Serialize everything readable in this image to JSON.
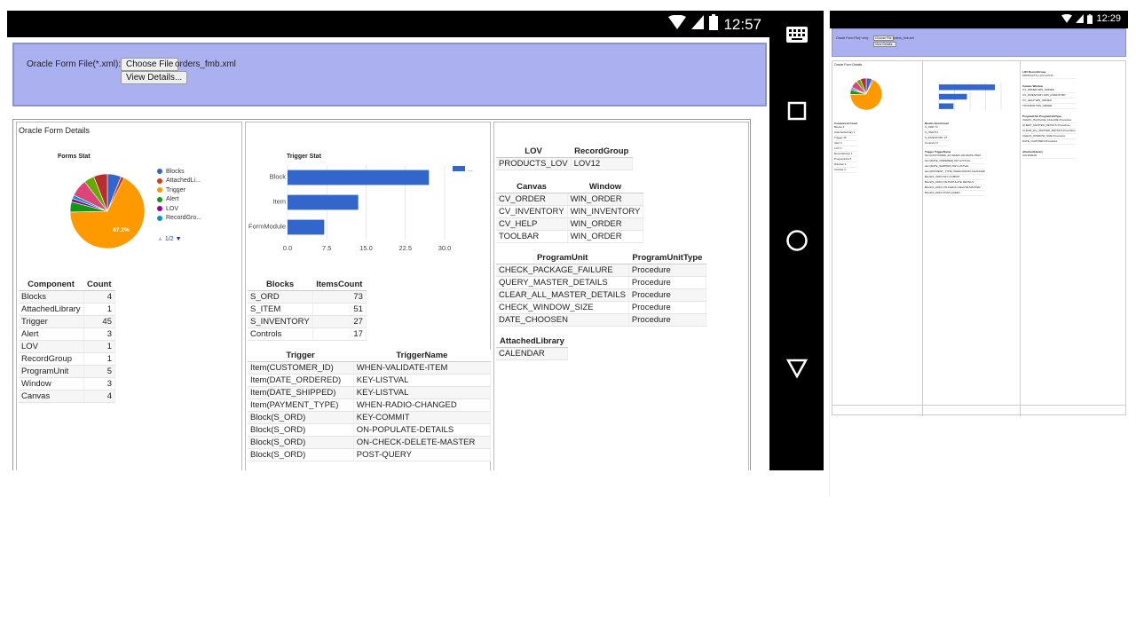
{
  "status_bar": {
    "time": "12:57"
  },
  "status_bar_portrait": {
    "time": "12:29"
  },
  "file_form": {
    "label": "Oracle Form File(*.xml):",
    "choose_button": "Choose File",
    "file_name": "orders_fmb.xml",
    "view_button": "View Details..."
  },
  "details": {
    "title": "Oracle Form Details"
  },
  "forms_stat_chart": {
    "title": "Forms Stat",
    "pie_label": "67.2%",
    "legend": [
      "Blocks",
      "AttachedLi...",
      "Trigger",
      "Alert",
      "LOV",
      "RecordGro..."
    ],
    "pager": "1/2"
  },
  "trigger_stat_chart": {
    "title": "Trigger Stat",
    "categories": [
      "Block",
      "Item",
      "FormModule"
    ],
    "ticks": [
      "0.0",
      "7.5",
      "15.0",
      "22.5",
      "30.0"
    ],
    "legend_text": "..."
  },
  "chart_data": [
    {
      "type": "pie",
      "title": "Forms Stat",
      "categories": [
        "Blocks",
        "AttachedLibrary",
        "Trigger",
        "Alert",
        "LOV",
        "RecordGroup",
        "ProgramUnit",
        "Window",
        "Canvas"
      ],
      "values": [
        4,
        1,
        45,
        3,
        1,
        1,
        5,
        3,
        4
      ],
      "colors": [
        "#3366cc",
        "#dc3912",
        "#ff9900",
        "#109618",
        "#990099",
        "#0099c6",
        "#dd4477",
        "#66aa00",
        "#b82e2e"
      ]
    },
    {
      "type": "bar",
      "orientation": "horizontal",
      "title": "Trigger Stat",
      "categories": [
        "Block",
        "Item",
        "FormModule"
      ],
      "values": [
        27,
        13.5,
        7
      ],
      "xlim": [
        0,
        30
      ]
    }
  ],
  "component_table": {
    "headers": [
      "Component",
      "Count"
    ],
    "rows": [
      [
        "Blocks",
        "4"
      ],
      [
        "AttachedLibrary",
        "1"
      ],
      [
        "Trigger",
        "45"
      ],
      [
        "Alert",
        "3"
      ],
      [
        "LOV",
        "1"
      ],
      [
        "RecordGroup",
        "1"
      ],
      [
        "ProgramUnit",
        "5"
      ],
      [
        "Window",
        "3"
      ],
      [
        "Canvas",
        "4"
      ]
    ]
  },
  "blocks_table": {
    "headers": [
      "Blocks",
      "ItemsCount"
    ],
    "rows": [
      [
        "S_ORD",
        "73"
      ],
      [
        "S_ITEM",
        "51"
      ],
      [
        "S_INVENTORY",
        "27"
      ],
      [
        "Controls",
        "17"
      ]
    ]
  },
  "trigger_table": {
    "headers": [
      "Trigger",
      "TriggerName"
    ],
    "rows": [
      [
        "Item(CUSTOMER_ID)",
        "WHEN-VALIDATE-ITEM"
      ],
      [
        "Item(DATE_ORDERED)",
        "KEY-LISTVAL"
      ],
      [
        "Item(DATE_SHIPPED)",
        "KEY-LISTVAL"
      ],
      [
        "Item(PAYMENT_TYPE)",
        "WHEN-RADIO-CHANGED"
      ],
      [
        "Block(S_ORD)",
        "KEY-COMMIT"
      ],
      [
        "Block(S_ORD)",
        "ON-POPULATE-DETAILS"
      ],
      [
        "Block(S_ORD)",
        "ON-CHECK-DELETE-MASTER"
      ],
      [
        "Block(S_ORD)",
        "POST-QUERY"
      ]
    ]
  },
  "lov_table": {
    "headers": [
      "LOV",
      "RecordGroup"
    ],
    "rows": [
      [
        "PRODUCTS_LOV",
        "LOV12"
      ]
    ]
  },
  "canvas_table": {
    "headers": [
      "Canvas",
      "Window"
    ],
    "rows": [
      [
        "CV_ORDER",
        "WIN_ORDER"
      ],
      [
        "CV_INVENTORY",
        "WIN_INVENTORY"
      ],
      [
        "CV_HELP",
        "WIN_ORDER"
      ],
      [
        "TOOLBAR",
        "WIN_ORDER"
      ]
    ]
  },
  "program_unit_table": {
    "headers": [
      "ProgramUnit",
      "ProgramUnitType"
    ],
    "rows": [
      [
        "CHECK_PACKAGE_FAILURE",
        "Procedure"
      ],
      [
        "QUERY_MASTER_DETAILS",
        "Procedure"
      ],
      [
        "CLEAR_ALL_MASTER_DETAILS",
        "Procedure"
      ],
      [
        "CHECK_WINDOW_SIZE",
        "Procedure"
      ],
      [
        "DATE_CHOOSEN",
        "Procedure"
      ]
    ]
  },
  "attached_library_table": {
    "headers": [
      "AttachedLibrary"
    ],
    "rows": [
      [
        "CALENDAR"
      ]
    ]
  },
  "nav": {
    "keyboard": "keyboard-icon",
    "recents": "square-icon",
    "home": "circle-icon",
    "back": "triangle-icon"
  }
}
